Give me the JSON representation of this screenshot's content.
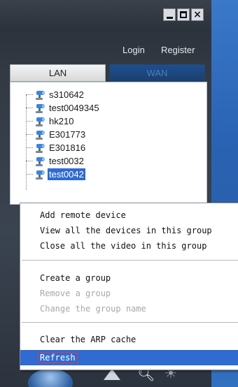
{
  "window": {
    "controls": {
      "minimize": "minimize",
      "maximize": "maximize",
      "close": "×"
    }
  },
  "header": {
    "login_label": "Login",
    "register_label": "Register"
  },
  "tabs": [
    {
      "label": "LAN",
      "active": true
    },
    {
      "label": "WAN",
      "active": false
    }
  ],
  "devices": [
    {
      "label": "s310642",
      "selected": false
    },
    {
      "label": "test0049345",
      "selected": false
    },
    {
      "label": "hk210",
      "selected": false
    },
    {
      "label": "E301773",
      "selected": false
    },
    {
      "label": "E301816",
      "selected": false
    },
    {
      "label": "test0032",
      "selected": false
    },
    {
      "label": "test0042",
      "selected": true
    }
  ],
  "context_menu": {
    "items": [
      {
        "label": "Add remote device",
        "enabled": true
      },
      {
        "label": "View all the devices in this group",
        "enabled": true
      },
      {
        "label": "Close all the video in this group",
        "enabled": true
      },
      {
        "label": "Create a group",
        "enabled": true
      },
      {
        "label": "Remove a group",
        "enabled": false
      },
      {
        "label": "Change the group name",
        "enabled": false
      },
      {
        "label": "Clear the ARP cache",
        "enabled": true
      },
      {
        "label": "Refresh",
        "enabled": true,
        "highlighted": true
      }
    ]
  },
  "icons": {
    "device": "camera-icon",
    "magnifier": "magnifier-icon",
    "brightness": "brightness-icon",
    "ptz_up": "ptz-up-icon"
  },
  "colors": {
    "selection": "#2f6bd1",
    "highlight_box": "#e23a3a",
    "wan_tab": "#1e4f8f"
  }
}
